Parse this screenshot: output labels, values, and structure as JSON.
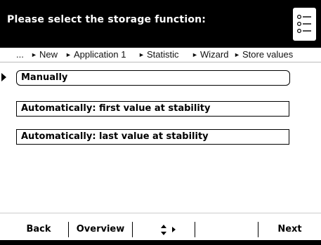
{
  "header": {
    "title": "Please select the storage function:",
    "icon": "list-options-icon"
  },
  "breadcrumb": {
    "ellipsis": "...",
    "separator": "►",
    "items": [
      "New",
      "Application 1",
      "Statistic",
      "Wizard",
      "Store values"
    ]
  },
  "options": {
    "items": [
      {
        "label": "Manually",
        "selected": true
      },
      {
        "label": "Automatically: first value at stability",
        "selected": false
      },
      {
        "label": "Automatically: last value at stability",
        "selected": false
      }
    ]
  },
  "footer": {
    "softkeys": [
      "Back",
      "Overview",
      "",
      "",
      "Next"
    ],
    "nav_icons": [
      "up-down-arrows-icon",
      "right-arrow-icon"
    ]
  },
  "colors": {
    "background": "#000000",
    "panel": "#ffffff",
    "text_dark": "#000000",
    "text_light": "#ffffff"
  }
}
